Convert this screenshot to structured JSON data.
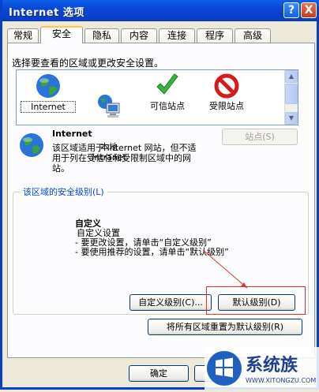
{
  "window": {
    "title": "Internet 选项"
  },
  "titlebar": {
    "help": "?",
    "close": "X"
  },
  "tabs": [
    {
      "label": "常规"
    },
    {
      "label": "安全"
    },
    {
      "label": "隐私"
    },
    {
      "label": "内容"
    },
    {
      "label": "连接"
    },
    {
      "label": "程序"
    },
    {
      "label": "高级"
    }
  ],
  "security": {
    "intro": "选择要查看的区域或更改安全设置。",
    "zones": [
      {
        "label": "Internet",
        "icon": "globe-icon"
      },
      {
        "label": "本地\nIntranet",
        "icon": "intranet-icon"
      },
      {
        "label": "可信站点",
        "icon": "checkmark-icon"
      },
      {
        "label": "受限站点",
        "icon": "restricted-icon"
      }
    ],
    "selected_zone": {
      "title": "Internet",
      "description": "该区域适用于 Internet 网站，但不适用于列在受信任和受限制区域中的网站。",
      "sites_button": "站点(S)"
    },
    "level_group": {
      "label": "该区域的安全级别(L)",
      "level_title": "自定义",
      "lines": [
        "自定义设置",
        "- 要更改设置，请单击“自定义级别”",
        "- 要使用推荐的设置，请单击“默认级别”"
      ],
      "custom_button": "自定义级别(C)...",
      "default_button": "默认级别(D)"
    },
    "reset_all_button": "将所有区域重置为默认级别(R)"
  },
  "footer": {
    "ok_button": "确定"
  },
  "watermark": {
    "text": "系统族",
    "url": "WWW.XITONGZU.COM"
  },
  "colors": {
    "titlebar": "#0b46d6",
    "accent_tab": "#ffc83c",
    "highlight": "#e23030",
    "group_label": "#0046d5"
  }
}
